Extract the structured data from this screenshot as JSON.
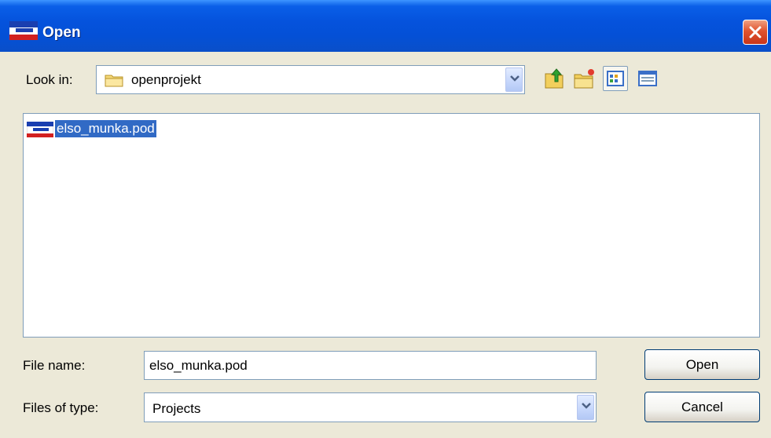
{
  "window": {
    "title": "Open"
  },
  "look_in": {
    "label": "Look in:",
    "value": "openprojekt"
  },
  "toolbar": {
    "icons": [
      "up-folder-icon",
      "new-folder-icon",
      "list-view-icon",
      "details-view-icon"
    ]
  },
  "files": [
    {
      "name": "elso_munka.pod",
      "selected": true
    }
  ],
  "file_name": {
    "label": "File name:",
    "value": "elso_munka.pod"
  },
  "file_type": {
    "label": "Files of type:",
    "value": "Projects"
  },
  "buttons": {
    "open": "Open",
    "cancel": "Cancel"
  },
  "colors": {
    "titlebar": "#0553dd",
    "selection": "#316ac5",
    "dialog_bg": "#ece9d8",
    "close": "#e0532e"
  }
}
